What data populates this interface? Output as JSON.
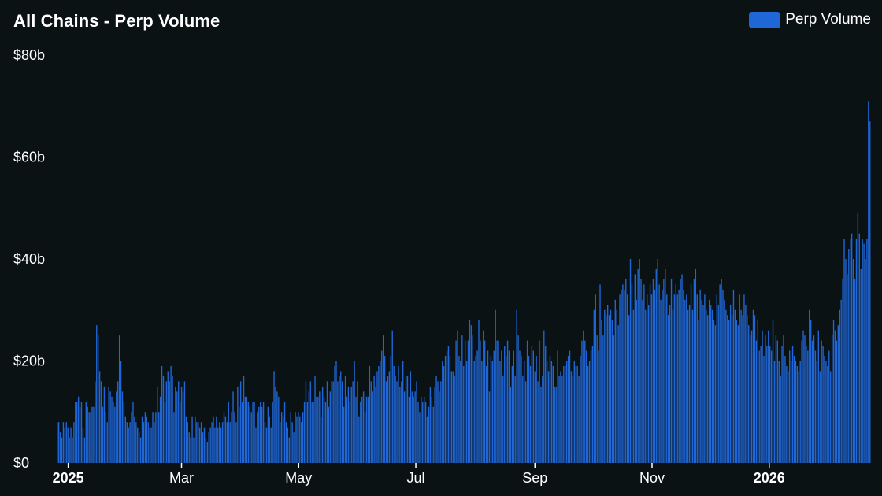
{
  "chart_data": {
    "type": "bar",
    "title": "All Chains - Perp Volume",
    "xlabel": "",
    "ylabel": "",
    "date_range": [
      "2024-12-26",
      "2026-02-23"
    ],
    "ylim": [
      0,
      80
    ],
    "yticks": [
      {
        "value": 0,
        "label": "$0"
      },
      {
        "value": 20,
        "label": "$20b"
      },
      {
        "value": 40,
        "label": "$40b"
      },
      {
        "value": 60,
        "label": "$60b"
      },
      {
        "value": 80,
        "label": "$80b"
      }
    ],
    "xticks": [
      {
        "date": "2025-01-01",
        "label": "2025",
        "bold": true
      },
      {
        "date": "2025-03-01",
        "label": "Mar",
        "bold": false
      },
      {
        "date": "2025-05-01",
        "label": "May",
        "bold": false
      },
      {
        "date": "2025-07-01",
        "label": "Jul",
        "bold": false
      },
      {
        "date": "2025-09-01",
        "label": "Sep",
        "bold": false
      },
      {
        "date": "2025-11-01",
        "label": "Nov",
        "bold": false
      },
      {
        "date": "2026-01-01",
        "label": "2026",
        "bold": true
      }
    ],
    "series": [
      {
        "name": "Perp Volume",
        "color": "#1f66d6",
        "unit": "$b",
        "values": [
          8,
          8,
          6,
          5,
          8,
          7,
          8,
          7,
          5,
          7,
          5,
          8,
          12,
          12,
          13,
          11,
          12,
          7,
          5,
          12,
          11,
          10,
          10,
          11,
          11,
          16,
          27,
          25,
          18,
          16,
          11,
          15,
          10,
          8,
          15,
          14,
          13,
          12,
          11,
          14,
          16,
          25,
          20,
          14,
          12,
          9,
          8,
          7,
          8,
          10,
          12,
          9,
          8,
          7,
          6,
          5,
          9,
          8,
          10,
          9,
          8,
          7,
          7,
          10,
          8,
          10,
          15,
          10,
          13,
          19,
          17,
          12,
          16,
          18,
          16,
          19,
          17,
          10,
          15,
          14,
          16,
          12,
          15,
          14,
          16,
          9,
          8,
          6,
          5,
          9,
          5,
          9,
          8,
          8,
          7,
          8,
          6,
          7,
          5,
          4,
          6,
          7,
          8,
          9,
          7,
          9,
          7,
          8,
          7,
          8,
          10,
          9,
          8,
          12,
          8,
          10,
          14,
          10,
          8,
          15,
          11,
          16,
          12,
          17,
          13,
          13,
          12,
          11,
          10,
          12,
          12,
          7,
          10,
          11,
          12,
          11,
          12,
          8,
          7,
          11,
          9,
          7,
          12,
          18,
          15,
          14,
          13,
          8,
          10,
          9,
          12,
          8,
          7,
          5,
          10,
          8,
          6,
          10,
          9,
          10,
          9,
          8,
          10,
          12,
          16,
          12,
          14,
          16,
          12,
          12,
          17,
          13,
          13,
          14,
          9,
          15,
          13,
          12,
          16,
          11,
          14,
          16,
          16,
          19,
          20,
          16,
          17,
          18,
          16,
          11,
          17,
          13,
          15,
          12,
          15,
          16,
          20,
          13,
          16,
          9,
          12,
          13,
          14,
          10,
          13,
          13,
          19,
          16,
          14,
          17,
          15,
          18,
          19,
          20,
          22,
          25,
          21,
          16,
          17,
          18,
          21,
          26,
          19,
          17,
          16,
          19,
          15,
          16,
          20,
          14,
          17,
          17,
          13,
          18,
          14,
          13,
          14,
          16,
          12,
          10,
          13,
          12,
          13,
          12,
          9,
          11,
          15,
          13,
          11,
          15,
          17,
          16,
          14,
          16,
          20,
          19,
          21,
          22,
          23,
          21,
          18,
          18,
          17,
          24,
          26,
          21,
          20,
          25,
          19,
          24,
          20,
          24,
          28,
          27,
          25,
          20,
          21,
          22,
          28,
          24,
          20,
          26,
          24,
          19,
          22,
          14,
          21,
          20,
          22,
          30,
          24,
          24,
          20,
          22,
          17,
          23,
          21,
          24,
          22,
          15,
          19,
          22,
          17,
          30,
          25,
          22,
          21,
          17,
          20,
          16,
          24,
          21,
          19,
          23,
          22,
          18,
          21,
          16,
          24,
          15,
          17,
          26,
          23,
          20,
          18,
          21,
          20,
          19,
          15,
          15,
          22,
          17,
          18,
          17,
          19,
          19,
          20,
          21,
          22,
          18,
          17,
          20,
          19,
          19,
          17,
          21,
          24,
          26,
          24,
          22,
          19,
          20,
          22,
          23,
          30,
          33,
          25,
          22,
          35,
          28,
          25,
          30,
          29,
          31,
          29,
          30,
          28,
          25,
          32,
          30,
          27,
          33,
          34,
          35,
          34,
          36,
          33,
          29,
          40,
          35,
          30,
          37,
          32,
          38,
          40,
          36,
          32,
          35,
          30,
          33,
          31,
          35,
          33,
          36,
          34,
          38,
          40,
          35,
          32,
          34,
          36,
          38,
          33,
          29,
          31,
          36,
          30,
          33,
          35,
          33,
          34,
          36,
          37,
          34,
          32,
          33,
          30,
          31,
          35,
          30,
          36,
          38,
          33,
          28,
          34,
          32,
          31,
          33,
          30,
          29,
          32,
          31,
          30,
          28,
          27,
          33,
          31,
          35,
          36,
          34,
          32,
          30,
          29,
          28,
          31,
          29,
          34,
          30,
          28,
          27,
          33,
          30,
          29,
          33,
          31,
          29,
          27,
          25,
          26,
          30,
          29,
          24,
          28,
          22,
          23,
          26,
          21,
          25,
          23,
          26,
          23,
          22,
          28,
          20,
          25,
          24,
          20,
          17,
          23,
          25,
          21,
          19,
          18,
          22,
          20,
          23,
          21,
          20,
          19,
          18,
          20,
          24,
          26,
          25,
          23,
          22,
          30,
          28,
          24,
          25,
          22,
          20,
          26,
          18,
          24,
          23,
          21,
          20,
          19,
          22,
          18,
          25,
          28,
          26,
          24,
          27,
          30,
          32,
          36,
          44,
          40,
          37,
          42,
          44,
          45,
          40,
          36,
          44,
          49,
          45,
          38,
          44,
          43,
          40,
          44,
          71,
          67
        ]
      }
    ]
  }
}
